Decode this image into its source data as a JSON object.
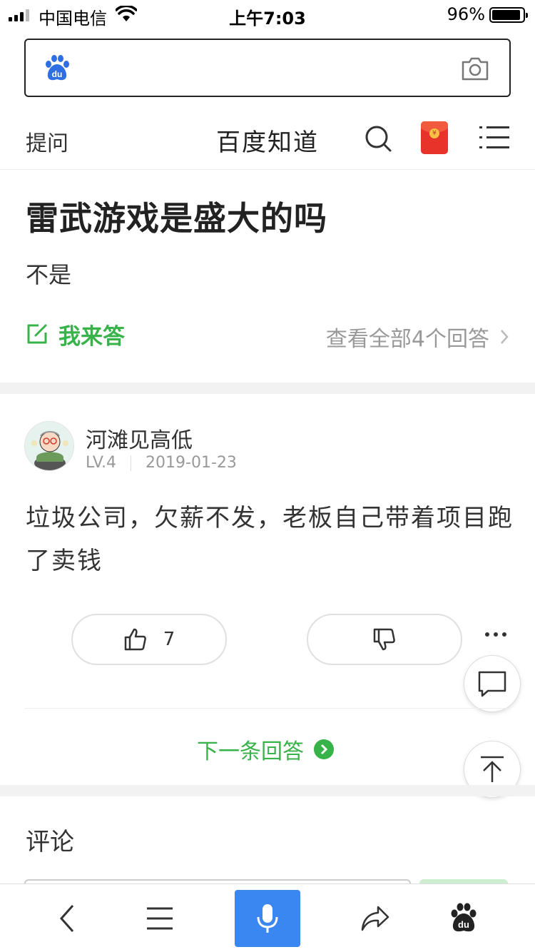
{
  "status_bar": {
    "carrier": "中国电信",
    "time": "上午7:03",
    "battery_percent": "96%"
  },
  "search": {
    "placeholder": ""
  },
  "nav": {
    "ask_label": "提问",
    "title": "百度知道"
  },
  "question": {
    "title": "雷武游戏是盛大的吗",
    "brief": "不是",
    "answer_button_label": "我来答",
    "view_all_label": "查看全部4个回答"
  },
  "answer": {
    "username": "河滩见高低",
    "level": "LV.4",
    "date": "2019-01-23",
    "text": "垃圾公司，欠薪不发，老板自己带着项目跑了卖钱",
    "like_count": "7"
  },
  "next_answer_label": "下一条回答",
  "comments": {
    "title": "评论"
  },
  "colors": {
    "accent_green": "#38b34a",
    "mic_blue": "#3b87f2",
    "baidu_blue": "#2f6fe4",
    "red_packet": "#e8332a"
  },
  "icons": {
    "search_logo": "baidu-paw-icon",
    "camera": "camera-icon",
    "search": "search-icon",
    "red_packet": "red-packet-icon",
    "menu": "menu-icon",
    "edit": "edit-icon",
    "chevron": "chevron-right-icon",
    "like": "thumbs-up-icon",
    "dislike": "thumbs-down-icon",
    "more": "more-icon",
    "comment": "comment-icon",
    "top": "back-to-top-icon",
    "back": "back-icon",
    "list": "list-icon",
    "mic": "mic-icon",
    "share": "share-icon",
    "home": "baidu-home-icon"
  }
}
